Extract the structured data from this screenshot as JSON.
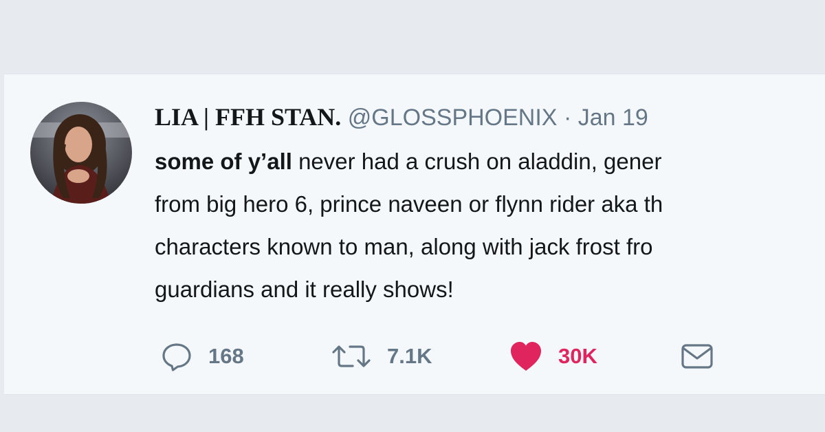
{
  "tweet": {
    "display_name": "LIA | FFH STAN.",
    "handle": "@GLOSSPHOENIX",
    "separator": "·",
    "date": "Jan 19",
    "lines": [
      {
        "bold": "some of y’all",
        "rest": " never had a crush on aladdin, gener"
      },
      {
        "bold": "",
        "rest": "from big hero 6, prince naveen or flynn rider aka th"
      },
      {
        "bold": "",
        "rest": "characters known to man, along with jack frost fro"
      },
      {
        "bold": "",
        "rest": "guardians and it really shows!"
      }
    ]
  },
  "actions": {
    "reply_count": "168",
    "retweet_count": "7.1K",
    "like_count": "30K"
  },
  "icons": {
    "reply": "speech-bubble-icon",
    "retweet": "retweet-arrows-icon",
    "like": "heart-icon",
    "message": "envelope-icon"
  },
  "colors": {
    "page_background": "#e7ebf0",
    "card_background": "#f5f8fa",
    "muted_text": "#657786",
    "like_active": "#e0245e",
    "primary_text": "#14171a"
  }
}
